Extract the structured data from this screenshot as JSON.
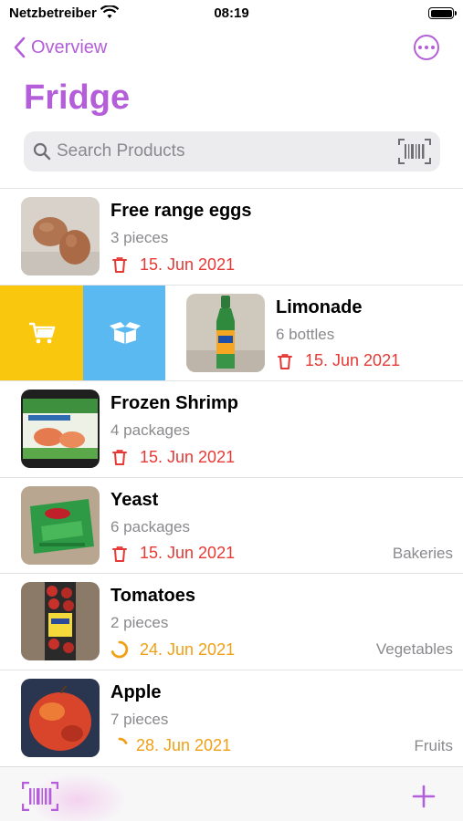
{
  "status_bar": {
    "carrier": "Netzbetreiber",
    "time": "08:19"
  },
  "nav": {
    "back_label": "Overview",
    "title": "Fridge"
  },
  "search": {
    "placeholder": "Search Products",
    "value": ""
  },
  "colors": {
    "accent": "#b45fd9",
    "expired": "#e53935",
    "soon": "#f0a016",
    "cart": "#f9c80e",
    "consume": "#5ab9f0"
  },
  "products": [
    {
      "name": "Free range eggs",
      "quantity": "3 pieces",
      "date": "15. Jun 2021",
      "category": "",
      "status": "expired",
      "thumb": "eggs"
    },
    {
      "name": "Limonade",
      "quantity": "6 bottles",
      "date": "15. Jun 2021",
      "category": "",
      "status": "expired",
      "thumb": "bottle"
    },
    {
      "name": "Frozen Shrimp",
      "quantity": "4 packages",
      "date": "15. Jun 2021",
      "category": "",
      "status": "expired",
      "thumb": "shrimp"
    },
    {
      "name": "Yeast",
      "quantity": "6 packages",
      "date": "15. Jun 2021",
      "category": "Bakeries",
      "status": "expired",
      "thumb": "yeast"
    },
    {
      "name": "Tomatoes",
      "quantity": "2 pieces",
      "date": "24. Jun 2021",
      "category": "Vegetables",
      "status": "soon",
      "thumb": "tomatoes"
    },
    {
      "name": "Apple",
      "quantity": "7 pieces",
      "date": "28. Jun 2021",
      "category": "Fruits",
      "status": "soon",
      "thumb": "apple"
    }
  ],
  "swipe_actions": {
    "left": "cart-icon",
    "right": "open-box-icon"
  },
  "toolbar": {
    "left": "barcode-scanner-icon",
    "right": "plus-icon"
  }
}
